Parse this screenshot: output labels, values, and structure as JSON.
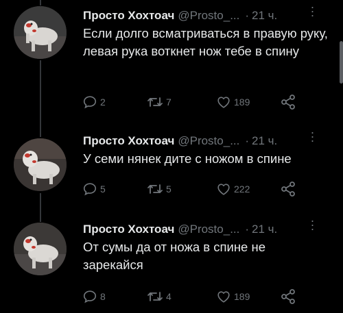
{
  "tweets": [
    {
      "author": "Просто Хохтоач",
      "handle": "@Prosto_...",
      "separator": "·",
      "time": "21 ч.",
      "text": "Если долго всматриваться в правую руку, левая рука воткнет нож тебе в спину",
      "replies": "2",
      "retweets": "7",
      "likes": "189"
    },
    {
      "author": "Просто Хохтоач",
      "handle": "@Prosto_...",
      "separator": "·",
      "time": "21 ч.",
      "text": "У семи нянек дите с ножом в спине",
      "replies": "5",
      "retweets": "5",
      "likes": "222"
    },
    {
      "author": "Просто Хохтоач",
      "handle": "@Prosto_...",
      "separator": "·",
      "time": "21 ч.",
      "text": "От сумы да от ножа в спине не зарекайся",
      "replies": "8",
      "retweets": "4",
      "likes": "189"
    }
  ],
  "icons": {
    "reply": "reply-icon",
    "retweet": "retweet-icon",
    "like": "heart-icon",
    "share": "share-icon",
    "more": "more-vertical-icon"
  },
  "colors": {
    "background": "#000000",
    "text": "#e7e9ea",
    "muted": "#71767b",
    "thread_line": "#33363a"
  }
}
